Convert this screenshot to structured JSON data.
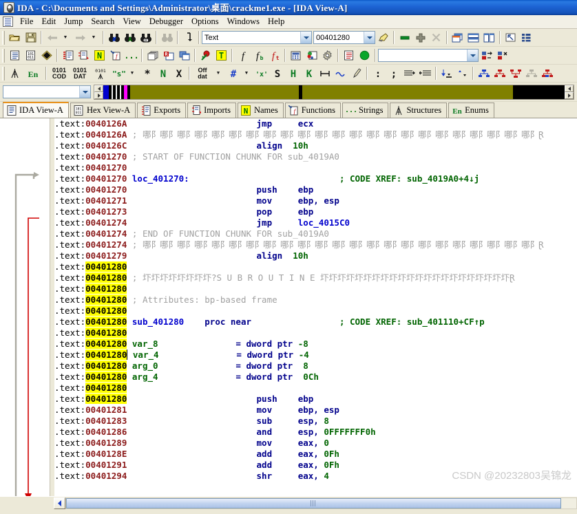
{
  "window": {
    "title": "IDA - C:\\Documents and Settings\\Administrator\\桌面\\crackme1.exe - [IDA View-A]",
    "icon": "ida-logo-icon"
  },
  "menu": {
    "items": [
      "File",
      "Edit",
      "Jump",
      "Search",
      "View",
      "Debugger",
      "Options",
      "Windows",
      "Help"
    ]
  },
  "toolbar": {
    "row1": {
      "open_icon": "open-folder-icon",
      "save_icon": "save-disk-icon",
      "back_icon": "arrow-back-icon",
      "forward_icon": "arrow-forward-icon",
      "search_binary_icon": "binoculars-hash-icon",
      "search_text_icon": "binoculars-a-icon",
      "search_imm_icon": "binoculars-101-icon",
      "search_again_icon": "binoculars-gray-icon",
      "jump_icon": "jump-arrow-icon",
      "search_combo_value": "Text",
      "address_combo_value": "00401280",
      "highlight_icon": "highlighter-icon",
      "minus_icon": "minus-icon",
      "plus_icon": "plus-icon",
      "close_icon": "close-x-icon",
      "tile_cascade_icon": "cascade-windows-icon",
      "tile_horiz_icon": "tile-horizontal-icon",
      "tile_vert_icon": "tile-vertical-icon",
      "arrange_icon": "arrange-icon",
      "list_icon": "list-icon"
    },
    "row2": {
      "doc_icon": "text-document-icon",
      "hex_icon": "hex-101-icon",
      "diamond_icon": "black-diamond-icon",
      "struct_icon": "struct-red-icon",
      "struct2_icon": "struct-stack-icon",
      "names_icon": "names-n-icon",
      "functions_icon": "functions-f-icon",
      "strings_icon": "strings-quote-icon",
      "copy_icon": "copy-windows-icon",
      "rename_icon": "rename-r-icon",
      "dup_icon": "duplicate-icon",
      "breakpoint_icon": "breakpoint-flag-icon",
      "text_t_icon": "text-t-icon",
      "func_f_icon": "italic-f-icon",
      "func_fb_icon": "italic-fb-icon",
      "func_ft_icon": "italic-ft-icon",
      "calc_icon": "calculator-icon",
      "options_icon": "options-palette-icon",
      "gear_icon": "gear-icon",
      "script_icon": "script-document-icon",
      "run_icon": "green-run-icon",
      "debugger_combo_value": "",
      "step_icon": "step-into-icon",
      "stop_icon": "step-stop-icon"
    },
    "row3": {
      "anchor_icon": "antenna-icon",
      "en_icon": "enums-en-icon",
      "code_icon": "0101-code-icon",
      "data_icon": "0101-data-icon",
      "struct_icon": "0101-struct-icon",
      "string_icon": "string-s-icon",
      "undefine_icon": "asterisk-icon",
      "name_icon": "name-n-icon",
      "delete_icon": "x-delete-icon",
      "offset_icon": "off-dat-icon",
      "hash_icon": "hash-blue-icon",
      "xref_icon": "x-quote-icon",
      "string_s_icon": "bold-s-icon",
      "hint_h_icon": "bold-h-icon",
      "key_k_icon": "bold-k-icon",
      "array_icon": "array-icon",
      "wave_icon": "wave-icon",
      "edit_icon": "pencil-icon",
      "colon_icon": "colon-icon",
      "semicolon_icon": "semicolon-icon",
      "anterior_icon": "anterior-comment-icon",
      "posterior_icon": "posterior-comment-icon",
      "collapse_icon": "collapse-icon",
      "expand_icon": "expand-icon",
      "graph1_icon": "flowchart-blue-icon",
      "graph2_icon": "call-graph-red-icon",
      "graph3_icon": "xrefs-to-icon",
      "graph4_icon": "xrefs-from-icon",
      "graph5_icon": "user-xref-icon"
    }
  },
  "navband": {
    "combo_value": "",
    "segments": [
      {
        "color": "#0000cd",
        "width": 1.2
      },
      {
        "color": "#000000",
        "width": 0.5
      },
      {
        "color": "#efefef",
        "width": 0.4
      },
      {
        "color": "#000000",
        "width": 0.5
      },
      {
        "color": "#efefef",
        "width": 0.4
      },
      {
        "color": "#000000",
        "width": 0.5
      },
      {
        "color": "#efefef",
        "width": 0.4
      },
      {
        "color": "#000000",
        "width": 0.5
      },
      {
        "color": "#ff00ff",
        "width": 0.8
      },
      {
        "color": "#000000",
        "width": 0.5
      },
      {
        "color": "#808000",
        "width": 36.0
      },
      {
        "color": "#000000",
        "width": 0.8
      },
      {
        "color": "#808000",
        "width": 45.0
      },
      {
        "color": "#000000",
        "width": 11.0
      }
    ]
  },
  "tabs": [
    {
      "label": "IDA View-A",
      "icon": "ida-view-icon",
      "active": true
    },
    {
      "label": "Hex View-A",
      "icon": "hex-view-icon",
      "active": false
    },
    {
      "label": "Exports",
      "icon": "exports-icon",
      "active": false
    },
    {
      "label": "Imports",
      "icon": "imports-icon",
      "active": false
    },
    {
      "label": "Names",
      "icon": "names-icon",
      "active": false
    },
    {
      "label": "Functions",
      "icon": "functions-icon",
      "active": false
    },
    {
      "label": "Strings",
      "icon": "strings-icon",
      "active": false
    },
    {
      "label": "Structures",
      "icon": "structures-icon",
      "active": false
    },
    {
      "label": "Enums",
      "icon": "enums-icon",
      "active": false
    }
  ],
  "disassembly": {
    "segment_prefix": ".text:",
    "lines": [
      {
        "addr": "0040126A",
        "hl": false,
        "dot": true,
        "mnem": "jmp",
        "ops": "ecx",
        "kind": "insn"
      },
      {
        "addr": "0040126A",
        "hl": false,
        "dot": false,
        "comment_dash": true,
        "kind": "dashes"
      },
      {
        "addr": "0040126C",
        "hl": false,
        "dot": true,
        "mnem": "align",
        "ops": "10h",
        "kind": "align"
      },
      {
        "addr": "00401270",
        "hl": false,
        "dot": false,
        "comment": "; START OF FUNCTION CHUNK FOR sub_4019A0",
        "kind": "comment"
      },
      {
        "addr": "00401270",
        "hl": false,
        "dot": false,
        "kind": "blank"
      },
      {
        "addr": "00401270",
        "hl": false,
        "dot": false,
        "label": "loc_401270:",
        "xref": "; CODE XREF: sub_4019A0+4↓j",
        "kind": "label"
      },
      {
        "addr": "00401270",
        "hl": false,
        "dot": true,
        "arrow": true,
        "mnem": "push",
        "ops": "ebp",
        "kind": "insn"
      },
      {
        "addr": "00401271",
        "hl": false,
        "dot": true,
        "mnem": "mov",
        "ops": "ebp, esp",
        "kind": "insn"
      },
      {
        "addr": "00401273",
        "hl": false,
        "dot": true,
        "mnem": "pop",
        "ops": "ebp",
        "kind": "insn"
      },
      {
        "addr": "00401274",
        "hl": false,
        "dot": true,
        "mnem": "jmp",
        "ops": "loc_4015C0",
        "kind": "insn_jmp"
      },
      {
        "addr": "00401274",
        "hl": false,
        "dot": false,
        "comment": "; END OF FUNCTION CHUNK FOR sub_4019A0",
        "kind": "comment"
      },
      {
        "addr": "00401274",
        "hl": false,
        "dot": false,
        "comment_dash": true,
        "kind": "dashes"
      },
      {
        "addr": "00401279",
        "hl": false,
        "dot": true,
        "mnem": "align",
        "ops": "10h",
        "kind": "align"
      },
      {
        "addr": "00401280",
        "hl": true,
        "dot": false,
        "kind": "blank"
      },
      {
        "addr": "00401280",
        "hl": true,
        "dot": false,
        "subroutine": true,
        "kind": "subbanner"
      },
      {
        "addr": "00401280",
        "hl": true,
        "dot": false,
        "kind": "blank"
      },
      {
        "addr": "00401280",
        "hl": true,
        "dot": false,
        "comment": "; Attributes: bp-based frame",
        "kind": "comment"
      },
      {
        "addr": "00401280",
        "hl": true,
        "dot": false,
        "kind": "blank"
      },
      {
        "addr": "00401280",
        "hl": true,
        "dot": false,
        "label": "sub_401280",
        "mnem": "proc near",
        "xref": "; CODE XREF: sub_401110+CF↑p",
        "kind": "proc"
      },
      {
        "addr": "00401280",
        "hl": true,
        "dot": false,
        "kind": "blank"
      },
      {
        "addr": "00401280",
        "hl": true,
        "dot": false,
        "var": "var_8",
        "vardef": "= dword ptr -8",
        "kind": "vardef"
      },
      {
        "addr": "00401280",
        "hl": true,
        "dot": false,
        "var": "var_4",
        "vardef": "= dword ptr -4",
        "kind": "vardef",
        "caret": true
      },
      {
        "addr": "00401280",
        "hl": true,
        "dot": false,
        "var": "arg_0",
        "vardef": "= dword ptr  8",
        "kind": "vardef"
      },
      {
        "addr": "00401280",
        "hl": true,
        "dot": false,
        "var": "arg_4",
        "vardef": "= dword ptr  0Ch",
        "kind": "vardef"
      },
      {
        "addr": "00401280",
        "hl": true,
        "dot": false,
        "kind": "blank"
      },
      {
        "addr": "00401280",
        "hl": true,
        "dot": true,
        "mnem": "push",
        "ops": "ebp",
        "kind": "insn"
      },
      {
        "addr": "00401281",
        "hl": false,
        "dot": true,
        "mnem": "mov",
        "ops": "ebp, esp",
        "kind": "insn"
      },
      {
        "addr": "00401283",
        "hl": false,
        "dot": true,
        "mnem": "sub",
        "ops": "esp, 8",
        "kind": "insn_num"
      },
      {
        "addr": "00401286",
        "hl": false,
        "dot": true,
        "mnem": "and",
        "ops": "esp, 0FFFFFFF0h",
        "kind": "insn_num"
      },
      {
        "addr": "00401289",
        "hl": false,
        "dot": true,
        "mnem": "mov",
        "ops": "eax, 0",
        "kind": "insn_num"
      },
      {
        "addr": "0040128E",
        "hl": false,
        "dot": true,
        "mnem": "add",
        "ops": "eax, 0Fh",
        "kind": "insn_num"
      },
      {
        "addr": "00401291",
        "hl": false,
        "dot": true,
        "mnem": "add",
        "ops": "eax, 0Fh",
        "kind": "insn_num"
      },
      {
        "addr": "00401294",
        "hl": false,
        "dot": true,
        "mnem": "shr",
        "ops": "eax, 4",
        "kind": "insn_num"
      }
    ]
  },
  "scrollbar": {
    "left_arrow_icon": "scroll-left-icon",
    "thumb_position_pct": 0,
    "thumb_width_pct": 97
  },
  "watermark": "CSDN @20232803吴锦龙",
  "colors": {
    "titlebar": "#1554bb",
    "toolbar_bg": "#ece9d8",
    "address": "#8b1a1a",
    "highlight": "#ffff00",
    "mnemonic": "#00008b",
    "number": "#006400",
    "label": "#0000cd",
    "comment": "#a0a0a0",
    "tab_active_accent": "#e8921c",
    "navband_olive": "#808000"
  }
}
